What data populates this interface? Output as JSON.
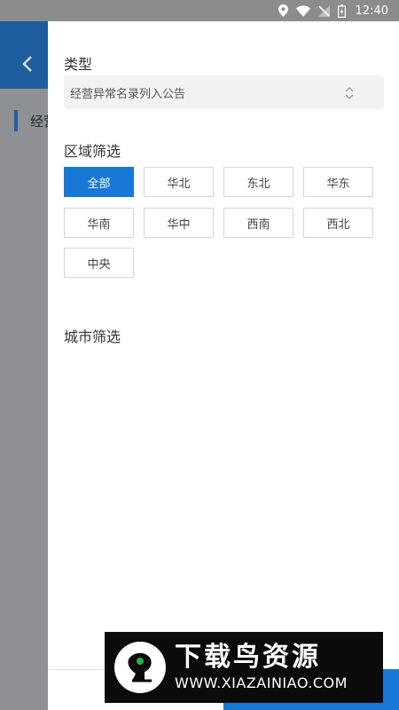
{
  "status_bar": {
    "time": "12:40"
  },
  "background_page": {
    "partial_label": "经营"
  },
  "drawer": {
    "type_section": {
      "title": "类型",
      "selected_value": "经营异常名录列入公告"
    },
    "region_section": {
      "title": "区域筛选",
      "options": [
        "全部",
        "华北",
        "东北",
        "华东",
        "华南",
        "华中",
        "西南",
        "西北",
        "中央"
      ],
      "selected": "全部"
    },
    "city_section": {
      "title": "城市筛选"
    }
  },
  "watermark": {
    "title": "下载鸟资源",
    "url": "WWW.XIAZAINIAO.COM"
  },
  "colors": {
    "accent": "#1878d6",
    "header_bg": "#1d5e9f",
    "scrim": "#8e9093"
  }
}
